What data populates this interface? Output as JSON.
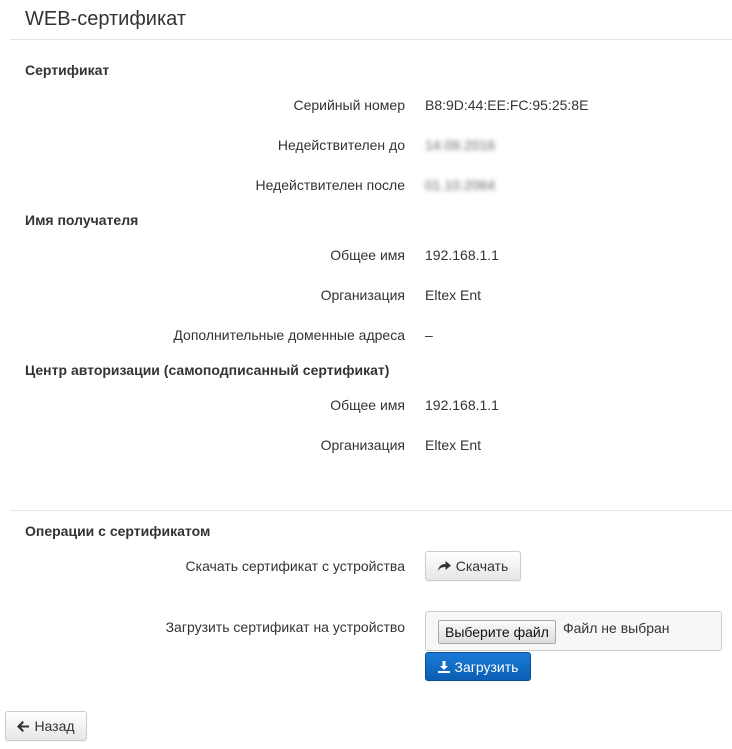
{
  "page": {
    "title": "WEB-сертификат"
  },
  "certificate": {
    "heading": "Сертификат",
    "serial_label": "Серийный номер",
    "serial_value": "B8:9D:44:EE:FC:95:25:8E",
    "not_before_label": "Недействителен до",
    "not_before_value": "14.09.2016",
    "not_after_label": "Недействителен после",
    "not_after_value": "01.10.2064"
  },
  "subject": {
    "heading": "Имя получателя",
    "cn_label": "Общее имя",
    "cn_value": "192.168.1.1",
    "org_label": "Организация",
    "org_value": "Eltex Ent",
    "san_label": "Дополнительные доменные адреса",
    "san_value": "–"
  },
  "issuer": {
    "heading": "Центр авторизации (самоподписанный сертификат)",
    "cn_label": "Общее имя",
    "cn_value": "192.168.1.1",
    "org_label": "Организация",
    "org_value": "Eltex Ent"
  },
  "operations": {
    "heading": "Операции с сертификатом",
    "download_label": "Скачать сертификат с устройства",
    "download_button": "Скачать",
    "upload_label": "Загрузить сертификат на устройство",
    "choose_file_button": "Выберите файл",
    "file_status": "Файл не выбран",
    "upload_button": "Загрузить"
  },
  "footer": {
    "back_button": "Назад"
  },
  "colors": {
    "primary": "#0b67c2",
    "text": "#333333",
    "rule": "#e5e5e5"
  },
  "icons": {
    "download": "share-arrow-icon",
    "upload": "download-icon",
    "back": "arrow-left-icon"
  }
}
